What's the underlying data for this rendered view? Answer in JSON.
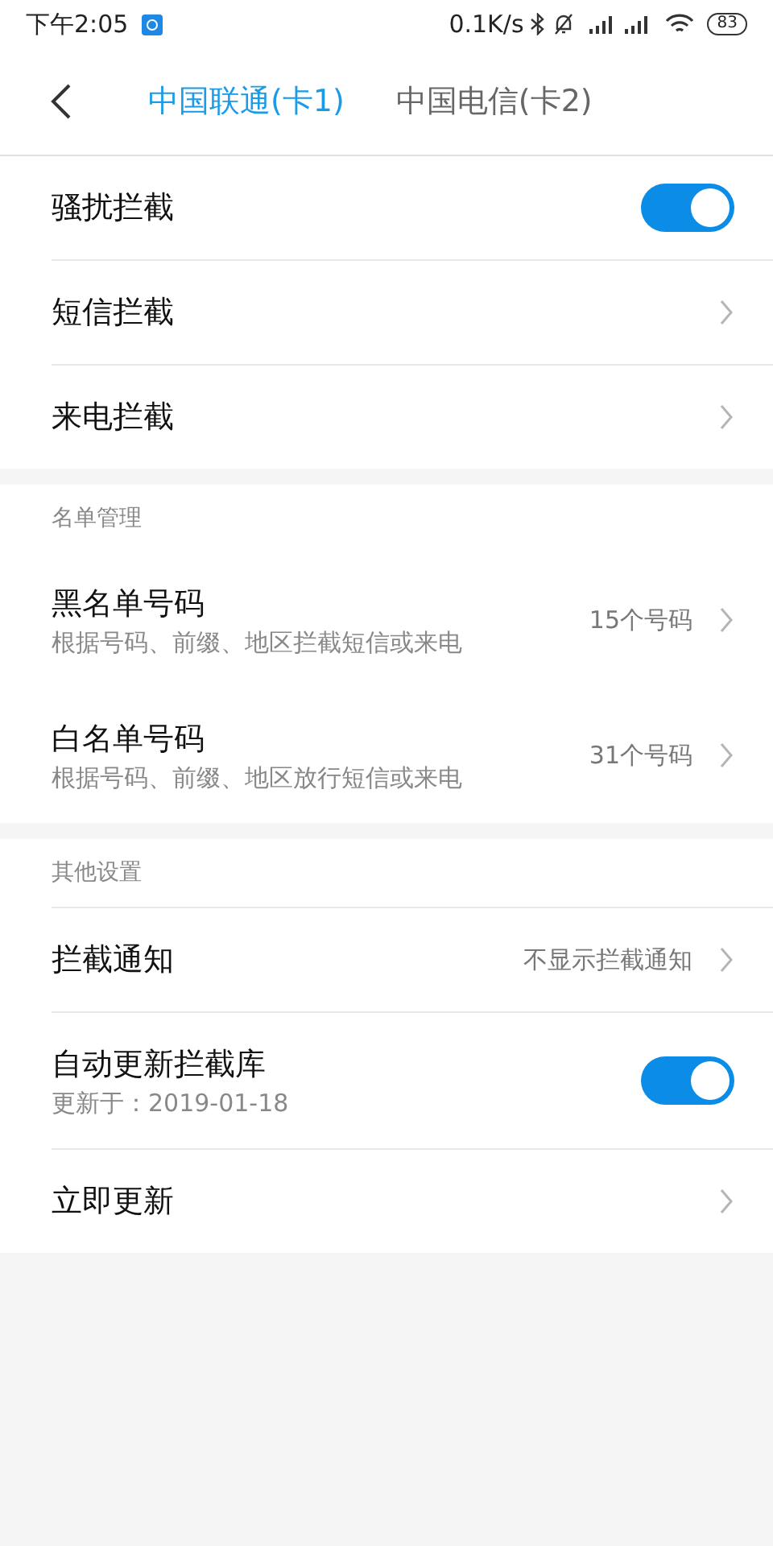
{
  "status_bar": {
    "time": "下午2:05",
    "speed": "0.1K/s",
    "battery": "83"
  },
  "tabs": [
    {
      "label": "中国联通(卡1)",
      "selected": true
    },
    {
      "label": "中国电信(卡2)",
      "selected": false
    }
  ],
  "sections": [
    {
      "rows": [
        {
          "kind": "toggle",
          "title": "骚扰拦截",
          "on": true
        },
        {
          "kind": "link",
          "title": "短信拦截"
        },
        {
          "kind": "link",
          "title": "来电拦截"
        }
      ]
    },
    {
      "header": "名单管理",
      "rows": [
        {
          "kind": "link",
          "title": "黑名单号码",
          "subtitle": "根据号码、前缀、地区拦截短信或来电",
          "value": "15个号码"
        },
        {
          "kind": "link",
          "title": "白名单号码",
          "subtitle": "根据号码、前缀、地区放行短信或来电",
          "value": "31个号码"
        }
      ]
    },
    {
      "header": "其他设置",
      "rows": [
        {
          "kind": "link",
          "title": "拦截通知",
          "value": "不显示拦截通知"
        },
        {
          "kind": "toggle",
          "title": "自动更新拦截库",
          "subtitle": "更新于：2019-01-18",
          "on": true
        },
        {
          "kind": "link",
          "title": "立即更新"
        }
      ]
    }
  ]
}
